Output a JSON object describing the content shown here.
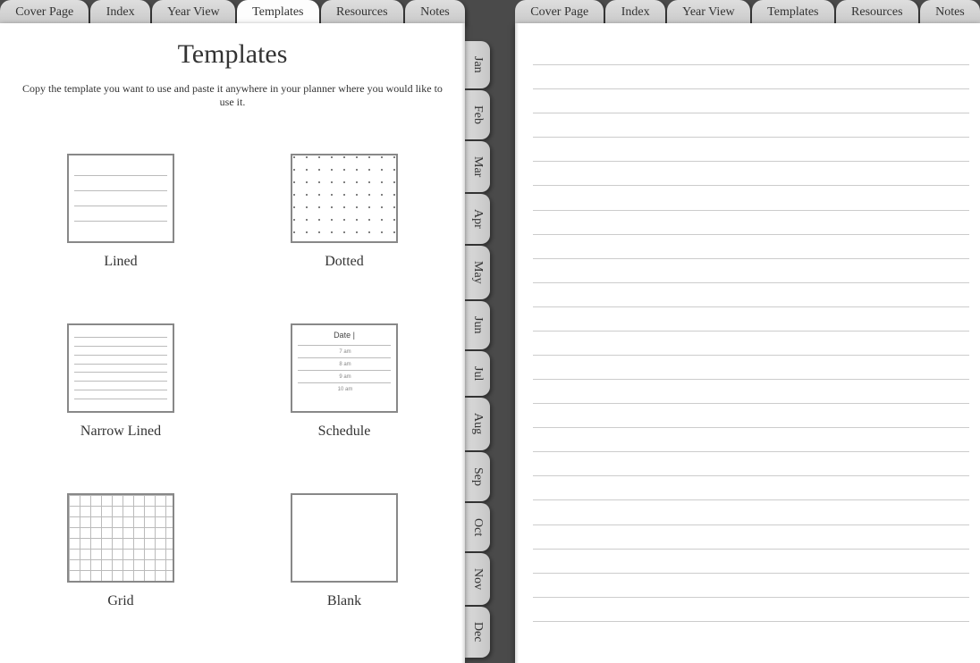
{
  "top_tabs": [
    {
      "label": "Cover Page"
    },
    {
      "label": "Index"
    },
    {
      "label": "Year View"
    },
    {
      "label": "Templates"
    },
    {
      "label": "Resources"
    },
    {
      "label": "Notes"
    }
  ],
  "months": [
    "Jan",
    "Feb",
    "Mar",
    "Apr",
    "May",
    "Jun",
    "Jul",
    "Aug",
    "Sep",
    "Oct",
    "Nov",
    "Dec"
  ],
  "left_page": {
    "title": "Templates",
    "subtitle": "Copy the template you want to use and paste it anywhere in your planner where you would like to use it.",
    "templates": [
      {
        "key": "lined",
        "label": "Lined"
      },
      {
        "key": "dotted",
        "label": "Dotted"
      },
      {
        "key": "narrow",
        "label": "Narrow Lined"
      },
      {
        "key": "schedule",
        "label": "Schedule"
      },
      {
        "key": "grid",
        "label": "Grid"
      },
      {
        "key": "blank",
        "label": "Blank"
      }
    ],
    "schedule_preview": {
      "date_label": "Date |",
      "times": [
        "7 am",
        "8 am",
        "9 am",
        "10 am"
      ]
    }
  }
}
